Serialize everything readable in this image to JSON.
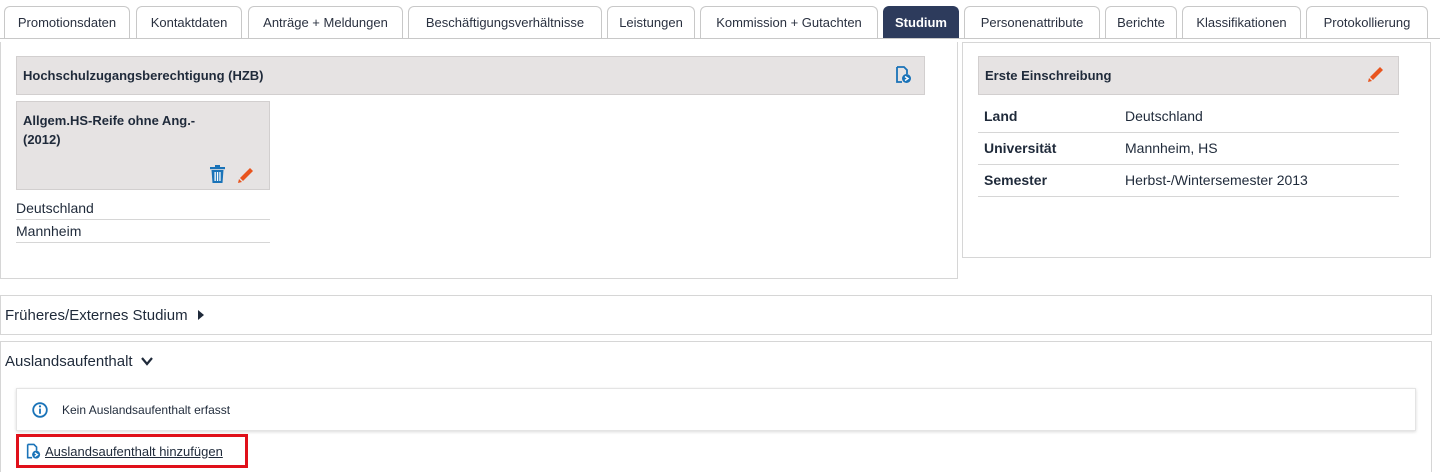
{
  "tabs": [
    {
      "label": "Promotionsdaten"
    },
    {
      "label": "Kontaktdaten"
    },
    {
      "label": "Anträge + Meldungen"
    },
    {
      "label": "Beschäftigungsverhältnisse"
    },
    {
      "label": "Leistungen"
    },
    {
      "label": "Kommission + Gutachten"
    },
    {
      "label": "Studium",
      "active": true
    },
    {
      "label": "Personenattribute"
    },
    {
      "label": "Berichte"
    },
    {
      "label": "Klassifikationen"
    },
    {
      "label": "Protokollierung"
    }
  ],
  "hzb": {
    "header": "Hochschulzugangsberechtigung (HZB)",
    "card_title": "Allgem.HS-Reife ohne Ang.-(2012)",
    "lines": [
      "Deutschland",
      "Mannheim"
    ]
  },
  "erste_einschreibung": {
    "header": "Erste Einschreibung",
    "rows": [
      {
        "key": "Land",
        "value": "Deutschland"
      },
      {
        "key": "Universität",
        "value": "Mannheim, HS"
      },
      {
        "key": "Semester",
        "value": "Herbst-/Wintersemester 2013"
      }
    ]
  },
  "frueheres_studium": {
    "title": "Früheres/Externes Studium"
  },
  "auslandsaufenthalt": {
    "title": "Auslandsaufenthalt",
    "info_text": "Kein Auslandsaufenthalt erfasst",
    "add_link": "Auslandsaufenthalt hinzufügen"
  },
  "colors": {
    "active_tab": "#2d3b5c",
    "accent_blue": "#1a73b8",
    "edit_orange": "#e8541e",
    "highlight_red": "#e0101a"
  },
  "icons": {
    "add_document": "add-document-icon",
    "edit": "pencil-icon",
    "delete": "trash-icon",
    "info": "info-icon",
    "chevron_right": "chevron-right-icon",
    "chevron_down": "chevron-down-icon"
  }
}
